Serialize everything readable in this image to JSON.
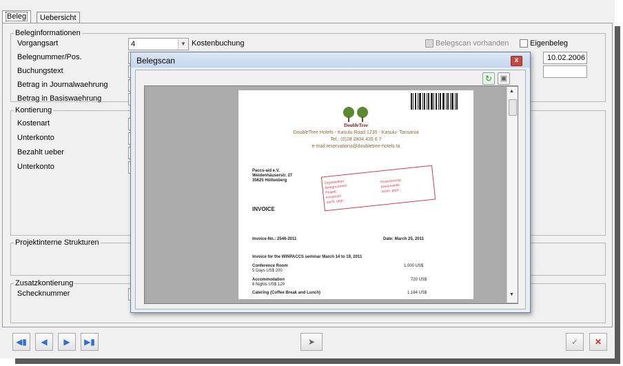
{
  "tabs": {
    "beleg": "Beleg",
    "uebersicht": "Uebersicht"
  },
  "belegInfo": {
    "legend": "Beleginformationen",
    "vorgangsart_label": "Vorgangsart",
    "vorgangsart_value": "4",
    "vorgangsart_text": "Kostenbuchung",
    "belegnummer_label": "Belegnummer/Pos.",
    "buchungstext_label": "Buchungstext",
    "betrag_journal_label": "Betrag in Journalwaehrung",
    "betrag_basis_label": "Betrag in Basiswaehrung",
    "belegscan_vorhanden": "Belegscan vorhanden",
    "eigenbeleg": "Eigenbeleg",
    "date": "10.02.2006"
  },
  "kontierung": {
    "legend": "Kontierung",
    "kostenart": "Kostenart",
    "unterkonto1": "Unterkonto",
    "bezahlt_ueber": "Bezahlt ueber",
    "unterkonto2": "Unterkonto"
  },
  "projekt": {
    "legend": "Projektinterne Strukturen"
  },
  "zusatz": {
    "legend": "Zusatzkontierung",
    "schecknummer": "Schecknummer"
  },
  "dialog": {
    "title": "Belegscan",
    "close": "x",
    "invoice": {
      "hotel_name": "DoubleTree",
      "hotel_line1": "DoubleTree Hotels - Kasulu Road 1235 - Kasulu- Tansania",
      "hotel_line2": "Tel.: (0)28 2804 435 6 7",
      "hotel_line3": "e-mail:reservations@doubletree-hotels.ta",
      "addr1": "Paccs-aid e.V.",
      "addr2": "Weidenhäuserstr. 27",
      "addr3": "35625 Hüttenberg",
      "heading": "INVOICE",
      "invoice_no": "Invoice-No.: 2546-2011",
      "invoice_date": "Date: March 25, 2011",
      "intro": "Invoice for the WINPACCS seminar March 14 to 19, 2011",
      "items": [
        {
          "name": "Conference Room",
          "detail": "5 Days US$ 200",
          "amount": "1.000 US$"
        },
        {
          "name": "Accommodation",
          "detail": "6 Nights US$ 120",
          "amount": "720 US$"
        },
        {
          "name": "Catering (Coffee Break and Lunch)",
          "detail": "",
          "amount": "1.184 US$"
        }
      ],
      "stamp": {
        "l1": "Organisation:",
        "l2": "Belegnummer:",
        "l3": "Projekt:",
        "l4": "Kostenart:",
        "l5": "sachl. gepr.:",
        "r1": "Finanzierung:",
        "r2": "Kostenstelle:",
        "r3": "rechn. gepr.:"
      }
    }
  },
  "colors": {
    "nav_blue": "#2f6fd0",
    "cancel_red": "#d03020",
    "ok_gray": "#808080"
  }
}
